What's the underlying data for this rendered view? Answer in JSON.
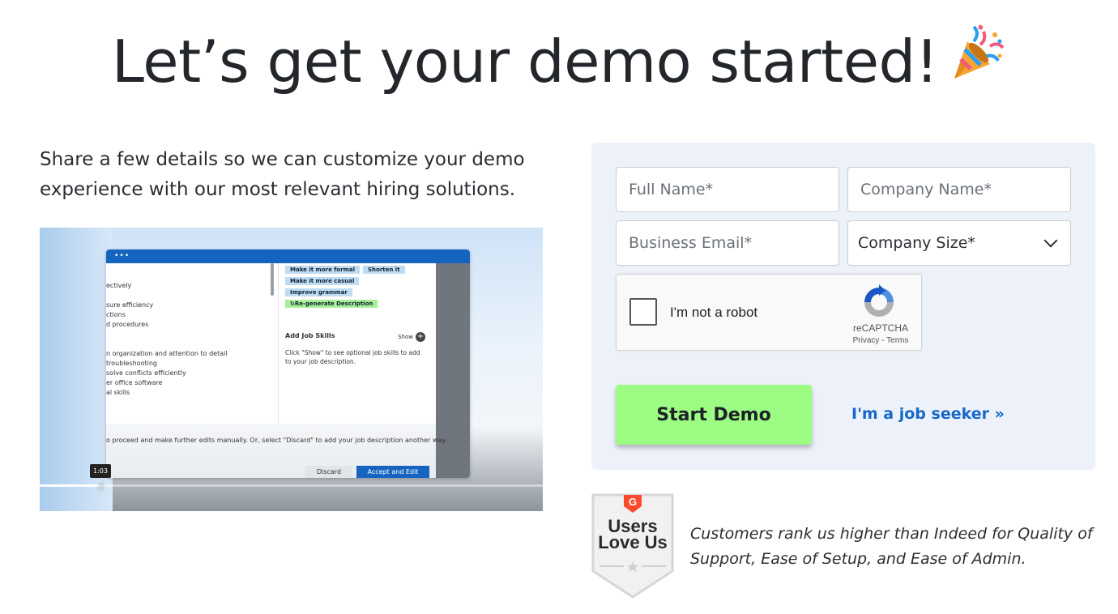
{
  "header": {
    "title": "Let’s get your demo started!",
    "emoji_icon": "party-popper-icon"
  },
  "intro": {
    "text": "Share a few details so we can customize your demo experience with our most relevant hiring solutions."
  },
  "video": {
    "time_label": "1:03",
    "progress": 0.126,
    "window": {
      "dots": "•••",
      "left_lines": [
        "ectively",
        "",
        "sure efficiency",
        "ctions",
        "d procedures",
        "",
        "",
        "n organization and attention to detail",
        " troubleshooting",
        " solve conflicts efficiently",
        "er office software",
        "al skills"
      ],
      "chips": [
        "Make it more formal",
        "Shorten it",
        "Make it more casual",
        "Improve grammar"
      ],
      "regen_chip": "↻Re-generate Description",
      "skills_title": "Add Job Skills",
      "skills_show": "Show",
      "skills_desc": "Click \"Show\" to see optional job skills to add to your job description.",
      "footer_msg": "o proceed and make further edits manually. Or, select \"Discard\" to add your job description another way.",
      "discard_label": "Discard",
      "accept_label": "Accept and Edit"
    }
  },
  "form": {
    "full_name_placeholder": "Full Name*",
    "company_name_placeholder": "Company Name*",
    "email_placeholder": "Business Email*",
    "company_size_label": "Company Size*",
    "captcha": {
      "label": "I'm not a robot",
      "brand": "reCAPTCHA",
      "terms": "Privacy - Terms"
    },
    "submit_label": "Start Demo",
    "seeker_link": "I'm a job seeker »"
  },
  "badge": {
    "logo": "G",
    "line1": "Users",
    "line2": "Love Us"
  },
  "quote": {
    "text": "Customers rank us higher than Indeed for Quality of Support, Ease of Setup, and Ease of Admin."
  },
  "colors": {
    "panel_bg": "#edf2fa",
    "button_green": "#9cfc84",
    "link_blue": "#1868c9",
    "g2_red": "#ff492c",
    "window_blue": "#1565c0"
  }
}
